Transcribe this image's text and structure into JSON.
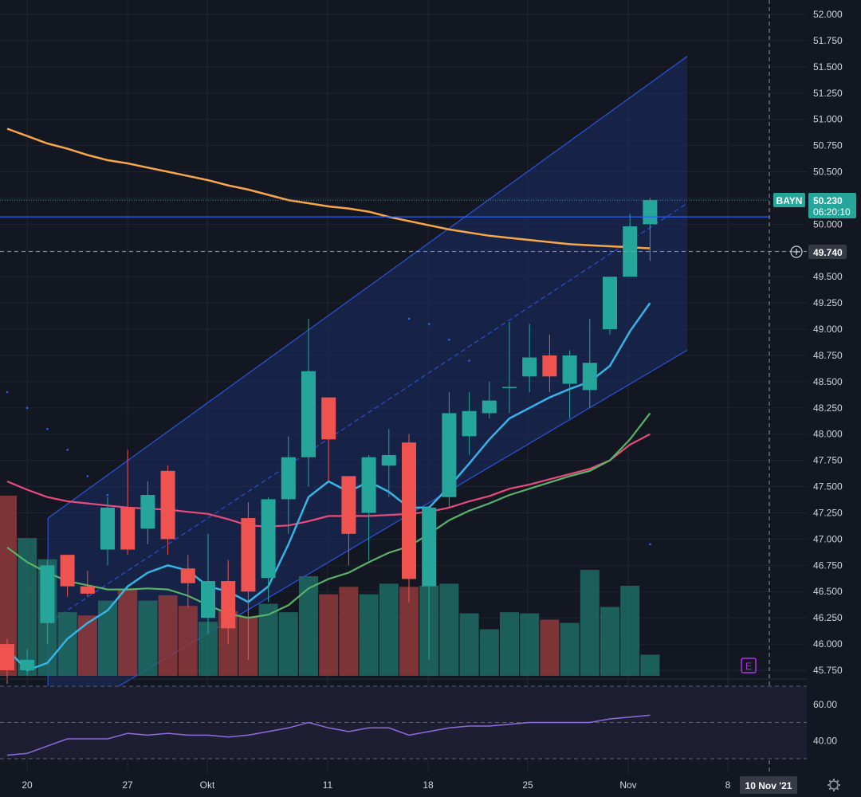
{
  "colors": {
    "background": "#131722",
    "grid": "#1f2430",
    "up": "#26a69a",
    "down": "#ef5350",
    "vol_up": "#1f6b63",
    "vol_down": "#8f3a3b",
    "sma200": "#f7a64b",
    "ema_fast": "#34b5e5",
    "sma50": "#59b26a",
    "sma_mid": "#e84b7c",
    "channel": "#2a50d0",
    "channel_fill": "#1b2b66",
    "rsi_line": "#8c6cdb",
    "rsi_band": "#1e1e33",
    "price_tag": "#26a69a",
    "ticker_tag": "#26a69a",
    "crosshair_tag": "#363a45",
    "earnings": "#b230e6"
  },
  "legend": {
    "ticker": "BAYN",
    "last_price": "50.230",
    "countdown": "06:20:10",
    "crosshair_price": "49.740",
    "crosshair_date": "10 Nov '21",
    "earnings_marker": "E"
  },
  "icons": {
    "crosshair_add": "plus-circle-icon",
    "settings": "gear-icon"
  },
  "chart_data": {
    "type": "candlestick",
    "symbol": "BAYN",
    "ylim": [
      45.7,
      52.1
    ],
    "y_ticks": [
      "52.000",
      "51.750",
      "51.500",
      "51.250",
      "51.000",
      "50.750",
      "50.500",
      "50.250",
      "50.000",
      "49.750",
      "49.500",
      "49.250",
      "49.000",
      "48.750",
      "48.500",
      "48.250",
      "48.000",
      "47.750",
      "47.500",
      "47.250",
      "47.000",
      "46.750",
      "46.500",
      "46.250",
      "46.000",
      "45.750"
    ],
    "x_ticks": [
      "20",
      "27",
      "Okt",
      "11",
      "18",
      "25",
      "Nov",
      "8"
    ],
    "horizontal_level": 50.07,
    "candles": [
      {
        "o": 46.0,
        "h": 46.05,
        "l": 45.62,
        "c": 45.75
      },
      {
        "o": 45.75,
        "h": 45.95,
        "l": 45.7,
        "c": 45.85
      },
      {
        "o": 46.2,
        "h": 46.8,
        "l": 46.0,
        "c": 46.75
      },
      {
        "o": 46.85,
        "h": 46.85,
        "l": 46.45,
        "c": 46.55
      },
      {
        "o": 46.55,
        "h": 46.7,
        "l": 46.45,
        "c": 46.48
      },
      {
        "o": 46.9,
        "h": 47.4,
        "l": 46.75,
        "c": 47.3
      },
      {
        "o": 47.3,
        "h": 47.85,
        "l": 46.85,
        "c": 46.9
      },
      {
        "o": 47.1,
        "h": 47.55,
        "l": 46.95,
        "c": 47.42
      },
      {
        "o": 47.65,
        "h": 47.7,
        "l": 46.85,
        "c": 47.0
      },
      {
        "o": 46.72,
        "h": 46.85,
        "l": 46.35,
        "c": 46.58
      },
      {
        "o": 46.25,
        "h": 47.05,
        "l": 46.1,
        "c": 46.6
      },
      {
        "o": 46.6,
        "h": 46.8,
        "l": 46.0,
        "c": 46.15
      },
      {
        "o": 47.2,
        "h": 47.35,
        "l": 45.85,
        "c": 46.5
      },
      {
        "o": 46.63,
        "h": 47.4,
        "l": 46.4,
        "c": 47.38
      },
      {
        "o": 47.38,
        "h": 47.98,
        "l": 47.05,
        "c": 47.78
      },
      {
        "o": 47.78,
        "h": 49.1,
        "l": 47.5,
        "c": 48.6
      },
      {
        "o": 48.35,
        "h": 48.2,
        "l": 47.55,
        "c": 47.95
      },
      {
        "o": 47.6,
        "h": 47.55,
        "l": 46.75,
        "c": 47.05
      },
      {
        "o": 47.25,
        "h": 47.8,
        "l": 46.8,
        "c": 47.78
      },
      {
        "o": 47.7,
        "h": 48.05,
        "l": 47.4,
        "c": 47.8
      },
      {
        "o": 47.92,
        "h": 48.0,
        "l": 46.4,
        "c": 46.62
      },
      {
        "o": 46.55,
        "h": 47.3,
        "l": 45.85,
        "c": 47.3
      },
      {
        "o": 47.4,
        "h": 48.4,
        "l": 47.3,
        "c": 48.2
      },
      {
        "o": 47.98,
        "h": 48.4,
        "l": 47.8,
        "c": 48.22
      },
      {
        "o": 48.2,
        "h": 48.5,
        "l": 48.15,
        "c": 48.32
      },
      {
        "o": 48.45,
        "h": 49.07,
        "l": 48.2,
        "c": 48.45
      },
      {
        "o": 48.55,
        "h": 49.05,
        "l": 48.4,
        "c": 48.73
      },
      {
        "o": 48.75,
        "h": 48.95,
        "l": 48.4,
        "c": 48.55
      },
      {
        "o": 48.48,
        "h": 48.8,
        "l": 48.15,
        "c": 48.75
      },
      {
        "o": 48.42,
        "h": 49.1,
        "l": 48.25,
        "c": 48.68
      },
      {
        "o": 49.0,
        "h": 49.5,
        "l": 48.95,
        "c": 49.5
      },
      {
        "o": 49.5,
        "h": 50.1,
        "l": 49.5,
        "c": 49.98
      },
      {
        "o": 50.0,
        "h": 50.25,
        "l": 49.65,
        "c": 50.23
      }
    ],
    "volume": [
      {
        "v": 17,
        "up": false
      },
      {
        "v": 13,
        "up": true
      },
      {
        "v": 11,
        "up": true
      },
      {
        "v": 6,
        "up": true
      },
      {
        "v": 5.7,
        "up": false
      },
      {
        "v": 7.1,
        "up": true
      },
      {
        "v": 8.2,
        "up": false
      },
      {
        "v": 7.1,
        "up": true
      },
      {
        "v": 7.6,
        "up": false
      },
      {
        "v": 6.6,
        "up": false
      },
      {
        "v": 5.1,
        "up": true
      },
      {
        "v": 6.1,
        "up": false
      },
      {
        "v": 5.6,
        "up": false
      },
      {
        "v": 6.8,
        "up": true
      },
      {
        "v": 6.0,
        "up": true
      },
      {
        "v": 9.4,
        "up": true
      },
      {
        "v": 7.7,
        "up": false
      },
      {
        "v": 8.4,
        "up": false
      },
      {
        "v": 7.7,
        "up": true
      },
      {
        "v": 8.7,
        "up": true
      },
      {
        "v": 8.4,
        "up": false
      },
      {
        "v": 8.5,
        "up": true
      },
      {
        "v": 8.7,
        "up": true
      },
      {
        "v": 5.9,
        "up": true
      },
      {
        "v": 4.4,
        "up": true
      },
      {
        "v": 6.0,
        "up": true
      },
      {
        "v": 5.9,
        "up": true
      },
      {
        "v": 5.3,
        "up": false
      },
      {
        "v": 5.0,
        "up": true
      },
      {
        "v": 10.0,
        "up": true
      },
      {
        "v": 6.5,
        "up": true
      },
      {
        "v": 8.5,
        "up": true
      },
      {
        "v": 2.0,
        "up": true
      }
    ],
    "sma200": [
      50.91,
      50.84,
      50.77,
      50.72,
      50.66,
      50.61,
      50.58,
      50.54,
      50.5,
      50.46,
      50.42,
      50.37,
      50.33,
      50.28,
      50.23,
      50.2,
      50.17,
      50.15,
      50.12,
      50.07,
      50.03,
      49.99,
      49.95,
      49.92,
      49.89,
      49.87,
      49.85,
      49.83,
      49.81,
      49.8,
      49.79,
      49.78,
      49.77
    ],
    "ema_fast": [
      45.95,
      45.75,
      45.82,
      46.05,
      46.2,
      46.32,
      46.55,
      46.68,
      46.75,
      46.7,
      46.55,
      46.5,
      46.4,
      46.55,
      46.95,
      47.4,
      47.55,
      47.45,
      47.55,
      47.45,
      47.3,
      47.3,
      47.5,
      47.72,
      47.95,
      48.15,
      48.25,
      48.35,
      48.43,
      48.5,
      48.65,
      48.98,
      49.25
    ],
    "sma50": [
      46.92,
      46.78,
      46.68,
      46.6,
      46.56,
      46.52,
      46.52,
      46.53,
      46.52,
      46.46,
      46.37,
      46.29,
      46.25,
      46.28,
      46.37,
      46.53,
      46.62,
      46.68,
      46.78,
      46.87,
      46.93,
      47.05,
      47.18,
      47.27,
      47.34,
      47.42,
      47.48,
      47.54,
      47.6,
      47.65,
      47.75,
      47.95,
      48.2
    ],
    "sma_mid": [
      47.55,
      47.47,
      47.4,
      47.36,
      47.34,
      47.32,
      47.3,
      47.29,
      47.28,
      47.26,
      47.24,
      47.19,
      47.13,
      47.12,
      47.13,
      47.17,
      47.22,
      47.22,
      47.22,
      47.23,
      47.24,
      47.26,
      47.3,
      47.36,
      47.41,
      47.48,
      47.52,
      47.57,
      47.62,
      47.67,
      47.75,
      47.9,
      48.0
    ],
    "channel": {
      "start_index": 1,
      "end_index": 33,
      "upper": [
        47.2,
        51.6
      ],
      "lower": [
        45.2,
        48.8
      ],
      "mid": [
        46.2,
        50.2
      ]
    },
    "rsi": {
      "ylim": [
        30,
        70
      ],
      "levels": [
        60.0,
        40.0
      ],
      "upper_band": 70,
      "lower_band": 30,
      "values": [
        32,
        33,
        37,
        41,
        41,
        41,
        44,
        43,
        44,
        43,
        43,
        42,
        43,
        45,
        47,
        50,
        47,
        45,
        47,
        47,
        43,
        45,
        47,
        48,
        48,
        49,
        50,
        50,
        50,
        50,
        52,
        53,
        54
      ]
    },
    "dots": [
      48.4,
      48.25,
      48.05,
      47.85,
      47.6,
      47.42,
      null,
      null,
      null,
      null,
      null,
      null,
      null,
      null,
      null,
      null,
      null,
      null,
      null,
      null,
      49.1,
      49.05,
      48.9,
      48.7,
      null,
      null,
      null,
      null,
      null,
      null,
      null,
      null,
      46.95
    ]
  }
}
